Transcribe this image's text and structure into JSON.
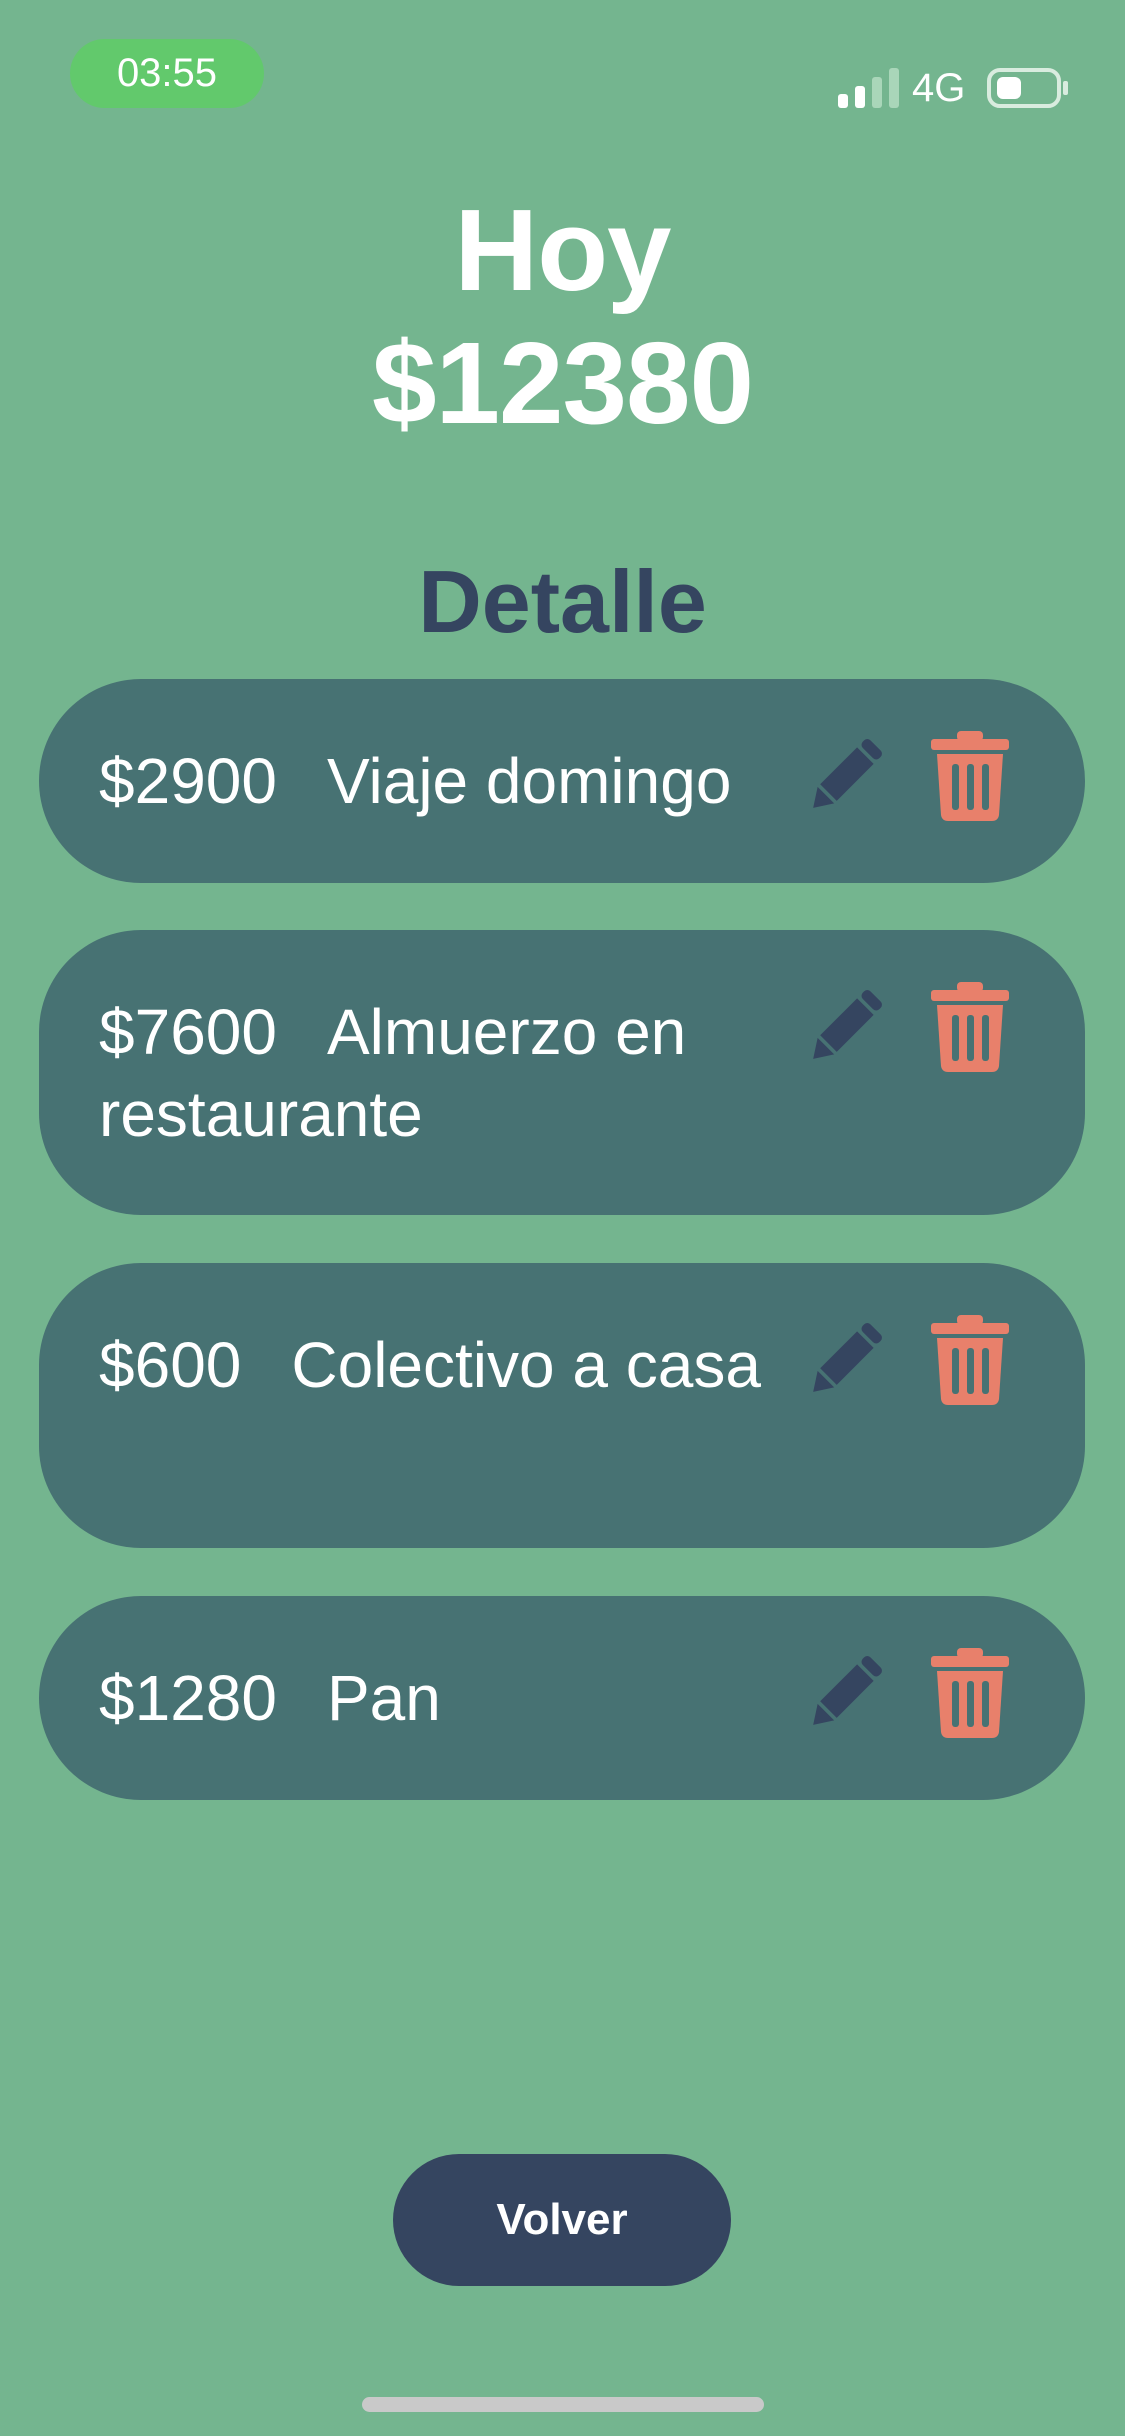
{
  "status_bar": {
    "time": "03:55",
    "network": "4G",
    "signal_icon": "signal-bars-icon",
    "battery_icon": "battery-icon",
    "battery_level": 0.4
  },
  "header": {
    "title": "Hoy",
    "total": "$12380"
  },
  "detail": {
    "heading": "Detalle"
  },
  "expenses": [
    {
      "amount": "$2900",
      "description": "Viaje domingo"
    },
    {
      "amount": "$7600",
      "description": "Almuerzo en restaurante"
    },
    {
      "amount": "$600",
      "description": "Colectivo a casa"
    },
    {
      "amount": "$1280",
      "description": "Pan"
    }
  ],
  "actions": {
    "edit_icon": "pencil-icon",
    "delete_icon": "trash-icon",
    "back_label": "Volver"
  },
  "colors": {
    "background": "#74b58f",
    "card": "#477273",
    "accent_dark": "#354560",
    "delete": "#e8806b",
    "time_pill": "#62c96c"
  }
}
